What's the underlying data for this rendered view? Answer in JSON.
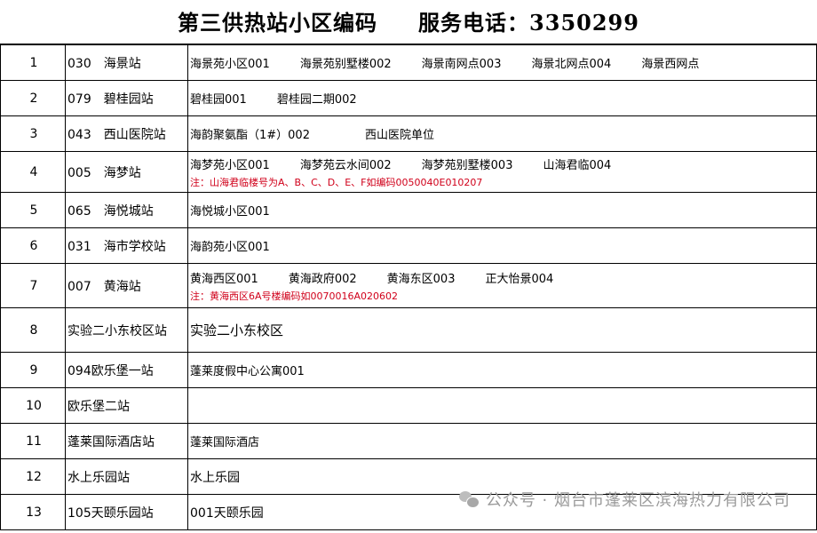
{
  "title": {
    "main": "第三供热站小区编码",
    "phone": "服务电话：3350299"
  },
  "rows": [
    {
      "no": "1",
      "station": "030　海景站",
      "items": [
        "海景苑小区001",
        "海景苑别墅楼002",
        "海景南网点003",
        "海景北网点004",
        "海景西网点"
      ],
      "note": ""
    },
    {
      "no": "2",
      "station": "079　碧桂园站",
      "items": [
        "碧桂园001",
        "碧桂园二期002"
      ],
      "note": ""
    },
    {
      "no": "3",
      "station": "043　西山医院站",
      "items": [
        "海韵聚氨酯（1#）002",
        "西山医院单位"
      ],
      "note": ""
    },
    {
      "no": "4",
      "station": "005　海梦站",
      "items": [
        "海梦苑小区001",
        "海梦苑云水间002",
        "海梦苑别墅楼003",
        "山海君临004"
      ],
      "note": "注：山海君临楼号为A、B、C、D、E、F如编码0050040E010207"
    },
    {
      "no": "5",
      "station": "065　海悦城站",
      "items": [
        "海悦城小区001"
      ],
      "note": ""
    },
    {
      "no": "6",
      "station": "031　海市学校站",
      "items": [
        "海韵苑小区001"
      ],
      "note": ""
    },
    {
      "no": "7",
      "station": "007　黄海站",
      "items": [
        "黄海西区001",
        "黄海政府002",
        "黄海东区003",
        "正大怡景004"
      ],
      "note": "注：黄海西区6A号楼编码如0070016A020602"
    },
    {
      "no": "8",
      "station": "实验二小东校区站",
      "items": [
        "实验二小东校区"
      ],
      "note": ""
    },
    {
      "no": "9",
      "station": "094欧乐堡一站",
      "items": [
        "蓬莱度假中心公寓001"
      ],
      "note": ""
    },
    {
      "no": "10",
      "station": "欧乐堡二站",
      "items": [],
      "note": ""
    },
    {
      "no": "11",
      "station": "蓬莱国际酒店站",
      "items": [
        "蓬莱国际酒店"
      ],
      "note": ""
    },
    {
      "no": "12",
      "station": "水上乐园站",
      "items": [
        "水上乐园"
      ],
      "note": ""
    },
    {
      "no": "13",
      "station": "105天颐乐园站",
      "items": [
        "001天颐乐园"
      ],
      "note": ""
    }
  ],
  "watermark": "公众号 · 烟台市蓬莱区滨海热力有限公司"
}
